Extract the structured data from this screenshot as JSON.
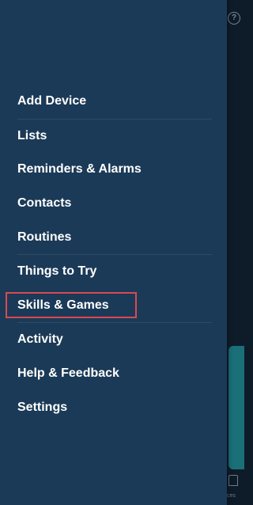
{
  "header": {
    "help_icon_glyph": "?"
  },
  "background": {
    "bottom_nav_label": "ces"
  },
  "menu": {
    "items": [
      {
        "label": "Add Device"
      },
      {
        "label": "Lists"
      },
      {
        "label": "Reminders & Alarms"
      },
      {
        "label": "Contacts"
      },
      {
        "label": "Routines"
      },
      {
        "label": "Things to Try"
      },
      {
        "label": "Skills & Games"
      },
      {
        "label": "Activity"
      },
      {
        "label": "Help & Feedback"
      },
      {
        "label": "Settings"
      }
    ],
    "highlighted_item": "Skills & Games"
  },
  "colors": {
    "drawer_bg": "#1b3a57",
    "highlight_border": "#d94a52",
    "accent_teal": "#1d7f86"
  }
}
